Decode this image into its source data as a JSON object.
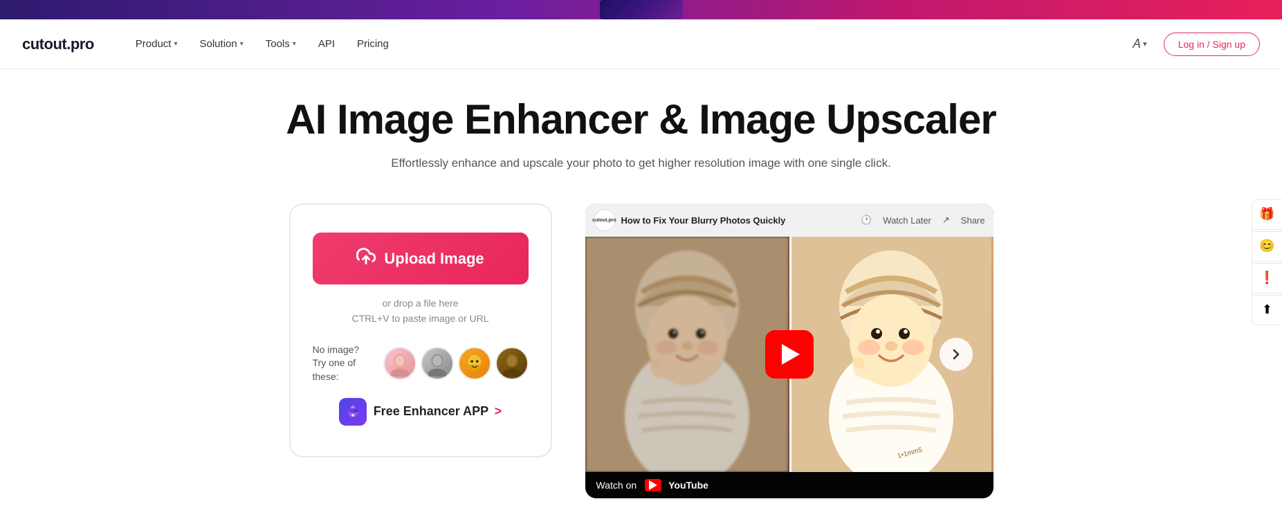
{
  "banner": {
    "alt": "Promotional banner"
  },
  "navbar": {
    "logo": "cutout.pro",
    "links": [
      {
        "label": "Product",
        "hasDropdown": true
      },
      {
        "label": "Solution",
        "hasDropdown": true
      },
      {
        "label": "Tools",
        "hasDropdown": true
      },
      {
        "label": "API",
        "hasDropdown": false
      },
      {
        "label": "Pricing",
        "hasDropdown": false
      }
    ],
    "lang_icon": "🌐",
    "lang_chevron": "∨",
    "login_label": "Log in / Sign up"
  },
  "hero": {
    "title": "AI Image Enhancer & Image Upscaler",
    "subtitle": "Effortlessly enhance and upscale your photo to get higher resolution image with one single click."
  },
  "upload": {
    "button_label": "Upload Image",
    "hint_line1": "or drop a file here",
    "hint_line2": "CTRL+V to paste image or URL",
    "sample_label_line1": "No image?",
    "sample_label_line2": "Try one of these:",
    "free_app_label": "Free Enhancer APP",
    "free_app_arrow": ">"
  },
  "video": {
    "avatar_label": "cutout.pro",
    "title": "How to Fix Your Blurry Photos Quickly",
    "watch_later": "Watch Later",
    "share": "Share",
    "watch_on": "Watch on",
    "youtube": "YouTube"
  },
  "side_actions": {
    "gift_icon": "🎁",
    "face_icon": "😊",
    "alert_icon": "❗",
    "upload_icon": "⬆"
  }
}
